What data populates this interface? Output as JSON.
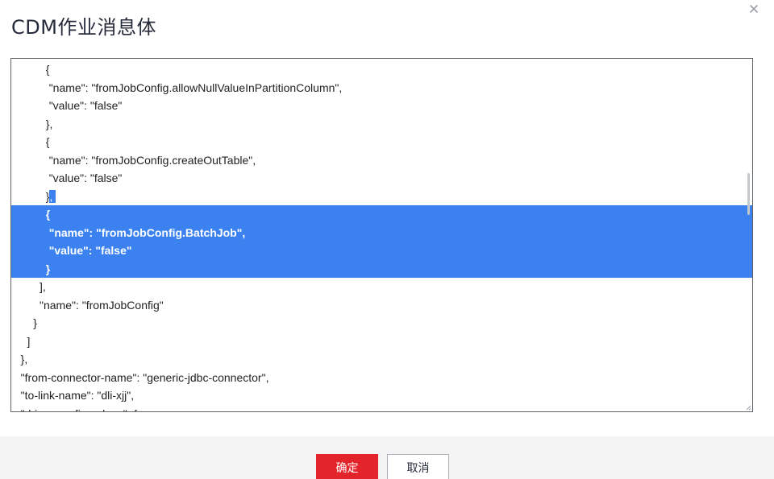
{
  "dialog": {
    "title": "CDM作业消息体",
    "close_icon": "close-icon"
  },
  "editor": {
    "lines": [
      {
        "indent": "           ",
        "text": "{",
        "sel": "none"
      },
      {
        "indent": "            ",
        "text": "\"name\": \"fromJobConfig.allowNullValueInPartitionColumn\",",
        "sel": "none"
      },
      {
        "indent": "            ",
        "text": "\"value\": \"false\"",
        "sel": "none"
      },
      {
        "indent": "           ",
        "text": "},",
        "sel": "none"
      },
      {
        "indent": "           ",
        "text": "{",
        "sel": "none"
      },
      {
        "indent": "            ",
        "text": "\"name\": \"fromJobConfig.createOutTable\",",
        "sel": "none"
      },
      {
        "indent": "            ",
        "text": "\"value\": \"false\"",
        "sel": "none"
      },
      {
        "indent": "           ",
        "text": "},",
        "sel": "partial"
      },
      {
        "indent": "           ",
        "text": "{",
        "sel": "full"
      },
      {
        "indent": "            ",
        "text": "\"name\": \"fromJobConfig.BatchJob\",",
        "sel": "full"
      },
      {
        "indent": "            ",
        "text": "\"value\": \"false\"",
        "sel": "full"
      },
      {
        "indent": "           ",
        "text": "}",
        "sel": "full"
      },
      {
        "indent": "         ",
        "text": "],",
        "sel": "none"
      },
      {
        "indent": "         ",
        "text": "\"name\": \"fromJobConfig\"",
        "sel": "none"
      },
      {
        "indent": "       ",
        "text": "}",
        "sel": "none"
      },
      {
        "indent": "     ",
        "text": "]",
        "sel": "none"
      },
      {
        "indent": "   ",
        "text": "},",
        "sel": "none"
      },
      {
        "indent": "   ",
        "text": "\"from-connector-name\": \"generic-jdbc-connector\",",
        "sel": "none"
      },
      {
        "indent": "   ",
        "text": "\"to-link-name\": \"dli-xjj\",",
        "sel": "none"
      },
      {
        "indent": "   ",
        "text": "\"driver-config-values\": {",
        "sel": "none"
      }
    ],
    "selection_color": "#3b82f0"
  },
  "footer": {
    "ok_label": "确定",
    "cancel_label": "取消",
    "ok_color": "#e4242b"
  }
}
